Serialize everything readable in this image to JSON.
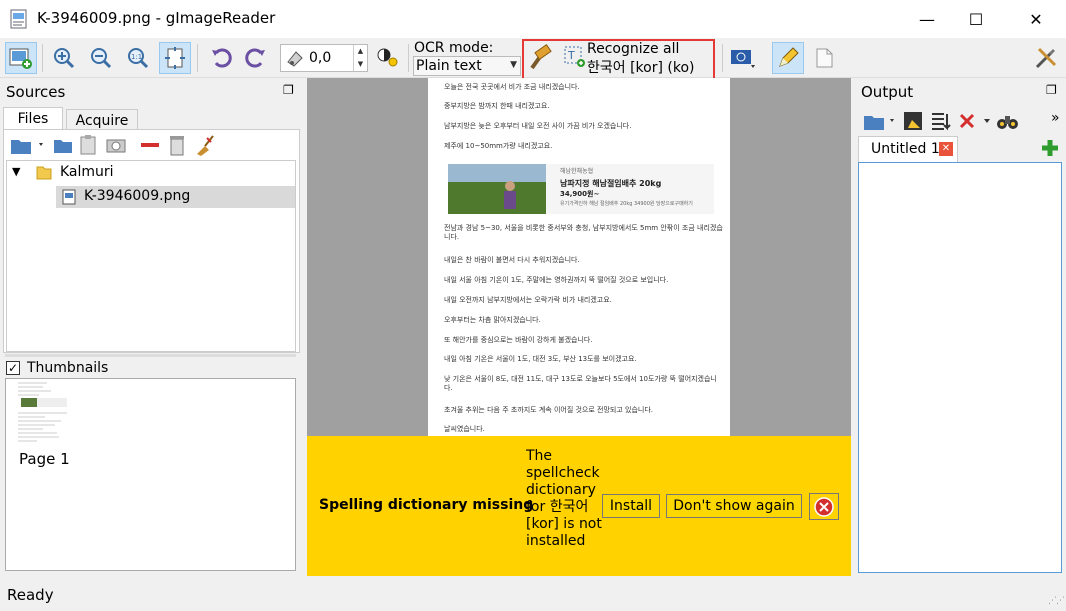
{
  "window": {
    "title": "K-3946009.png - gImageReader",
    "minimize_glyph": "—",
    "maximize_glyph": "☐",
    "close_glyph": "✕"
  },
  "toolbar": {
    "rotation_value": "0,0",
    "ocr_mode_label": "OCR mode:",
    "ocr_mode_value": "Plain text",
    "recognize_line1": "Recognize all",
    "recognize_line2": "한국어 [kor] (ko)"
  },
  "sources": {
    "header": "Sources",
    "tabs": [
      "Files",
      "Acquire"
    ],
    "tree": [
      {
        "label": "Kalmuri",
        "type": "folder"
      },
      {
        "label": "K-3946009.png",
        "type": "file",
        "selected": true
      }
    ],
    "thumbnails_label": "Thumbnails",
    "thumbnails_checked": true,
    "page_label": "Page 1"
  },
  "document": {
    "paragraphs": [
      "오늘은 전국 곳곳에서 비가 조금 내리겠습니다.",
      "중부지방은 밤까지 한때 내리겠고요.",
      "남부지방은 늦은 오후부터 내일 오전 사이 가끔 비가 오겠습니다.",
      "제주에 10~50mm가량 내리겠고요.",
      "전남과 경남 5~30, 서울을 비롯한 중서부와 충청, 남부지방에서도 5mm 안팎이 조금 내리겠습니다.",
      "내일은 찬 바람이 불면서 다시 추워지겠습니다.",
      "내일 서울 아침 기온이 1도, 주말에는 영하권까지 뚝 떨어질 것으로 보입니다.",
      "내일 오전까지 남부지방에서는 오락가락 비가 내리겠고요.",
      "오후부터는 차츰 맑아지겠습니다.",
      "또 해안가를 중심으로는 바람이 강하게 불겠습니다.",
      "내일 아침 기온은 서울이 1도, 대전 3도, 부산 13도를 보이겠고요.",
      "낮 기온은 서울이 8도, 대전 11도, 대구 13도로 오늘보다 5도에서 10도가량 뚝 떨어지겠습니다.",
      "초겨울 추위는 다음 주 초까지도 계속 이어질 것으로 전망되고 있습니다.",
      "날씨였습니다."
    ],
    "ad": {
      "shop": "해남한채농협",
      "title": "남파지정 해남절임배추 20kg",
      "price": "34,900원~",
      "desc": "유기가격인하 해남 절임배추 20kg 34900원 당장으로구매하기"
    }
  },
  "infobar": {
    "title": "Spelling dictionary missing",
    "message": "The spellcheck dictionary for 한국어 [kor] is not installed",
    "install_label": "Install",
    "dont_show_label": "Don't show again"
  },
  "output": {
    "header": "Output",
    "tab_label": "Untitled 1",
    "overflow_glyph": "»"
  },
  "status": {
    "text": "Ready"
  },
  "colors": {
    "accent": "#1e73d0",
    "highlight_border": "#e53935",
    "infobar": "#ffd200",
    "close_red": "#d32f2f",
    "add_green": "#2e9d2e"
  }
}
